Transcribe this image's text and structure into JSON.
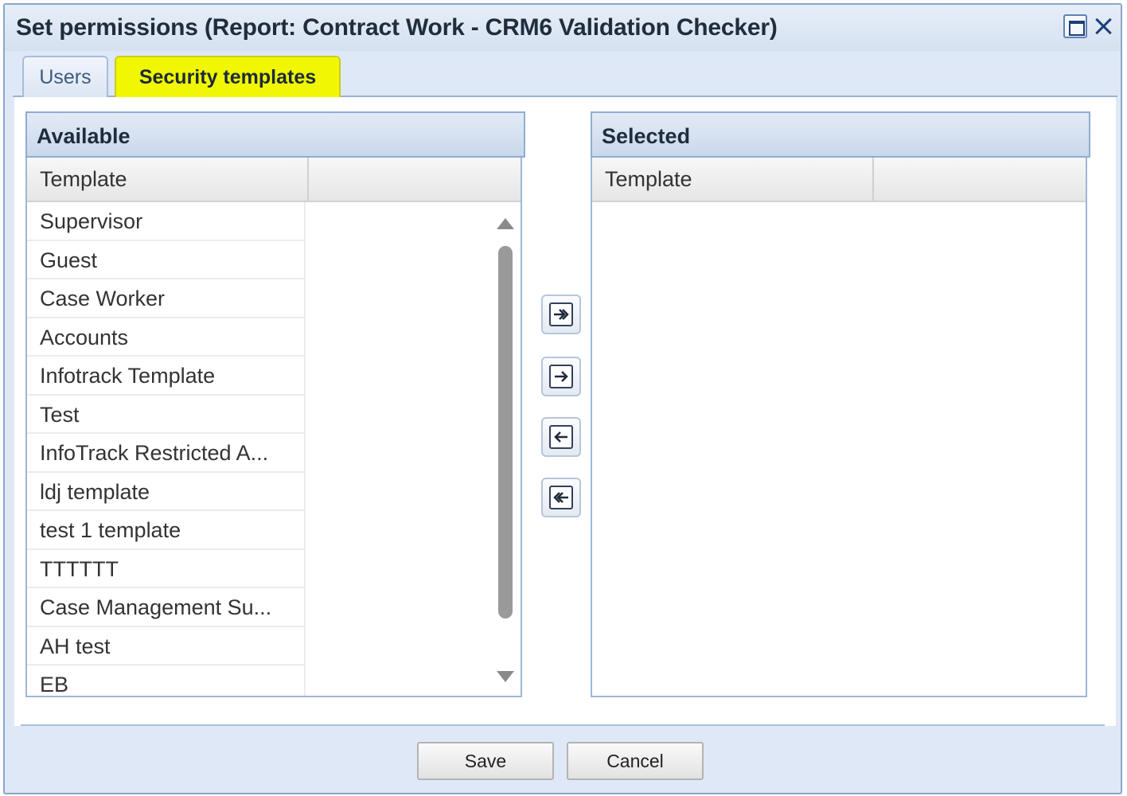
{
  "window": {
    "title": "Set permissions (Report: Contract Work - CRM6 Validation Checker)"
  },
  "tabs": [
    {
      "label": "Users",
      "active": false
    },
    {
      "label": "Security templates",
      "active": true,
      "highlight_color": "#f1f700"
    }
  ],
  "available": {
    "header": "Available",
    "column": "Template",
    "items": [
      "Supervisor",
      "Guest",
      "Case Worker",
      "Accounts",
      "Infotrack Template",
      "Test",
      "InfoTrack Restricted A...",
      "ldj template",
      "test 1 template",
      "TTTTTT",
      "Case Management Su...",
      "AH test",
      "EB"
    ]
  },
  "selected": {
    "header": "Selected",
    "column": "Template",
    "items": []
  },
  "movers": {
    "add_all": "add-all-icon",
    "add": "add-icon",
    "remove": "remove-icon",
    "remove_all": "remove-all-icon"
  },
  "buttons": {
    "save": "Save",
    "cancel": "Cancel"
  },
  "colors": {
    "frame": "#dfe8f6",
    "header_border": "#8fadd2"
  }
}
